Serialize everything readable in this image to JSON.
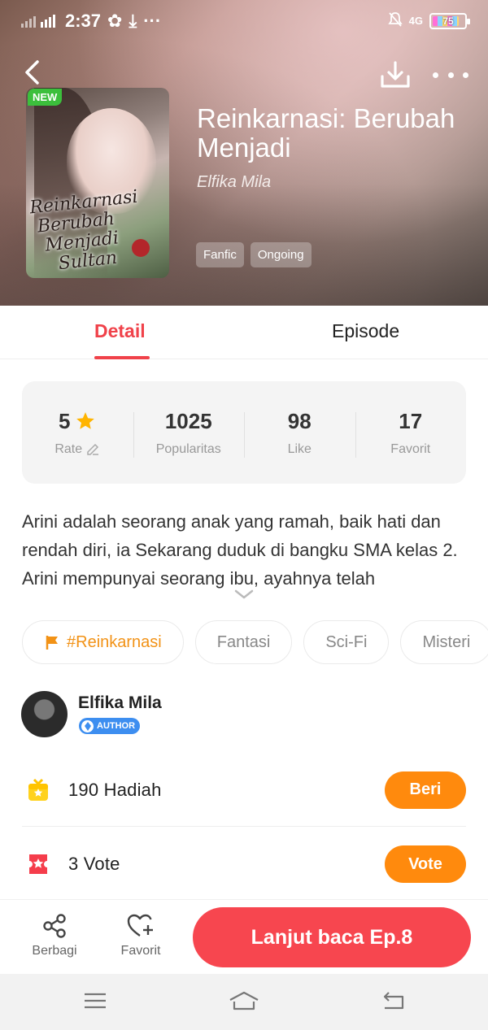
{
  "status_bar": {
    "time": "2:37",
    "network_left": "4G",
    "network_right": "4G",
    "battery": "75"
  },
  "book": {
    "badge": "NEW",
    "title": "Reinkarnasi: Berubah Menjadi",
    "author": "Elfika Mila",
    "genres": [
      "Fanfic",
      "Ongoing"
    ],
    "cover_script": "Reinkarnasi Berubah Menjadi Sultan"
  },
  "tabs": {
    "detail": "Detail",
    "episode": "Episode",
    "active": "detail"
  },
  "stats": {
    "rate_value": "5",
    "rate_label": "Rate",
    "popularity_value": "1025",
    "popularity_label": "Popularitas",
    "like_value": "98",
    "like_label": "Like",
    "favorite_value": "17",
    "favorite_label": "Favorit"
  },
  "synopsis": "Arini adalah seorang anak yang ramah, baik hati dan rendah diri, ia Sekarang duduk di bangku SMA kelas 2. Arini mempunyai seorang ibu, ayahnya telah",
  "keywords": [
    "#Reinkarnasi",
    "Fantasi",
    "Sci-Fi",
    "Misteri"
  ],
  "author_section": {
    "name": "Elfika Mila",
    "badge": "AUTHOR"
  },
  "support": {
    "gift_count": "190",
    "gift_label": "Hadiah",
    "gift_button": "Beri",
    "vote_count": "3",
    "vote_label": "Vote",
    "vote_button": "Vote"
  },
  "bottom_bar": {
    "share": "Berbagi",
    "favorite": "Favorit",
    "continue": "Lanjut baca Ep.8"
  },
  "colors": {
    "accent_red": "#f0424a",
    "button_orange": "#ff8a0d",
    "read_button": "#f7464f",
    "tag_orange": "#f29216",
    "new_badge": "#3cbf3c",
    "author_badge": "#3d8ef0"
  }
}
